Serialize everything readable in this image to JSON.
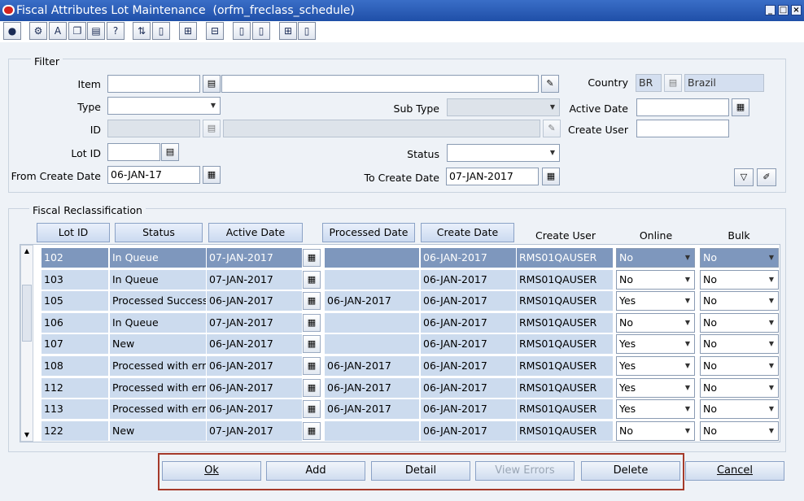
{
  "window": {
    "title": "Fiscal Attributes Lot Maintenance  (orfm_freclass_schedule)",
    "controls": [
      "minimize-icon",
      "maximize-icon",
      "close-icon"
    ]
  },
  "toolbar": {
    "icons": [
      "globe-icon",
      "options-icon",
      "spell-icon",
      "copy-icon",
      "print-icon",
      "help-icon",
      "transfer-icon",
      "new-icon",
      "tree-icon",
      "tree-alt-icon",
      "doc-icon",
      "doc-alt-icon",
      "tree-add-icon",
      "doc-add-icon"
    ]
  },
  "filter": {
    "title": "Filter",
    "item_label": "Item",
    "item_value": "",
    "item_desc": "",
    "type_label": "Type",
    "type_value": "",
    "subtype_label": "Sub Type",
    "subtype_value": "",
    "id_label": "ID",
    "id_value": "",
    "id_desc": "",
    "lotid_label": "Lot ID",
    "lotid_value": "",
    "status_label": "Status",
    "status_value": "",
    "from_date_label": "From Create Date",
    "from_date_value": "06-JAN-17",
    "to_date_label": "To Create Date",
    "to_date_value": "07-JAN-2017",
    "country_label": "Country",
    "country_code": "BR",
    "country_name": "Brazil",
    "active_date_label": "Active Date",
    "active_date_value": "",
    "create_user_label": "Create User",
    "create_user_value": ""
  },
  "reclass": {
    "title": "Fiscal Reclassification",
    "headers": {
      "lot_id": "Lot ID",
      "status": "Status",
      "active_date": "Active Date",
      "processed_date": "Processed Date",
      "create_date": "Create Date",
      "create_user": "Create User",
      "online": "Online",
      "bulk": "Bulk"
    },
    "rows": [
      {
        "lot_id": "102",
        "status": "In Queue",
        "active_date": "07-JAN-2017",
        "processed_date": "",
        "create_date": "06-JAN-2017",
        "create_user": "RMS01QAUSER",
        "online": "No",
        "bulk": "No"
      },
      {
        "lot_id": "103",
        "status": "In Queue",
        "active_date": "07-JAN-2017",
        "processed_date": "",
        "create_date": "06-JAN-2017",
        "create_user": "RMS01QAUSER",
        "online": "No",
        "bulk": "No"
      },
      {
        "lot_id": "105",
        "status": "Processed Success",
        "active_date": "06-JAN-2017",
        "processed_date": "06-JAN-2017",
        "create_date": "06-JAN-2017",
        "create_user": "RMS01QAUSER",
        "online": "Yes",
        "bulk": "No"
      },
      {
        "lot_id": "106",
        "status": "In Queue",
        "active_date": "07-JAN-2017",
        "processed_date": "",
        "create_date": "06-JAN-2017",
        "create_user": "RMS01QAUSER",
        "online": "No",
        "bulk": "No"
      },
      {
        "lot_id": "107",
        "status": "New",
        "active_date": "06-JAN-2017",
        "processed_date": "",
        "create_date": "06-JAN-2017",
        "create_user": "RMS01QAUSER",
        "online": "Yes",
        "bulk": "No"
      },
      {
        "lot_id": "108",
        "status": "Processed with erro",
        "active_date": "06-JAN-2017",
        "processed_date": "06-JAN-2017",
        "create_date": "06-JAN-2017",
        "create_user": "RMS01QAUSER",
        "online": "Yes",
        "bulk": "No"
      },
      {
        "lot_id": "112",
        "status": "Processed with erro",
        "active_date": "06-JAN-2017",
        "processed_date": "06-JAN-2017",
        "create_date": "06-JAN-2017",
        "create_user": "RMS01QAUSER",
        "online": "Yes",
        "bulk": "No"
      },
      {
        "lot_id": "113",
        "status": "Processed with erro",
        "active_date": "06-JAN-2017",
        "processed_date": "06-JAN-2017",
        "create_date": "06-JAN-2017",
        "create_user": "RMS01QAUSER",
        "online": "Yes",
        "bulk": "No"
      },
      {
        "lot_id": "122",
        "status": "New",
        "active_date": "07-JAN-2017",
        "processed_date": "",
        "create_date": "06-JAN-2017",
        "create_user": "RMS01QAUSER",
        "online": "No",
        "bulk": "No"
      }
    ]
  },
  "buttons": {
    "ok": "Ok",
    "add": "Add",
    "detail": "Detail",
    "view_errors": "View Errors",
    "delete": "Delete",
    "cancel": "Cancel"
  },
  "colors": {
    "titlebar": "#1f4fa8",
    "selected_row": "#7e97bd",
    "row_bg": "#ccdbee",
    "highlight_frame": "#a53a2a"
  }
}
